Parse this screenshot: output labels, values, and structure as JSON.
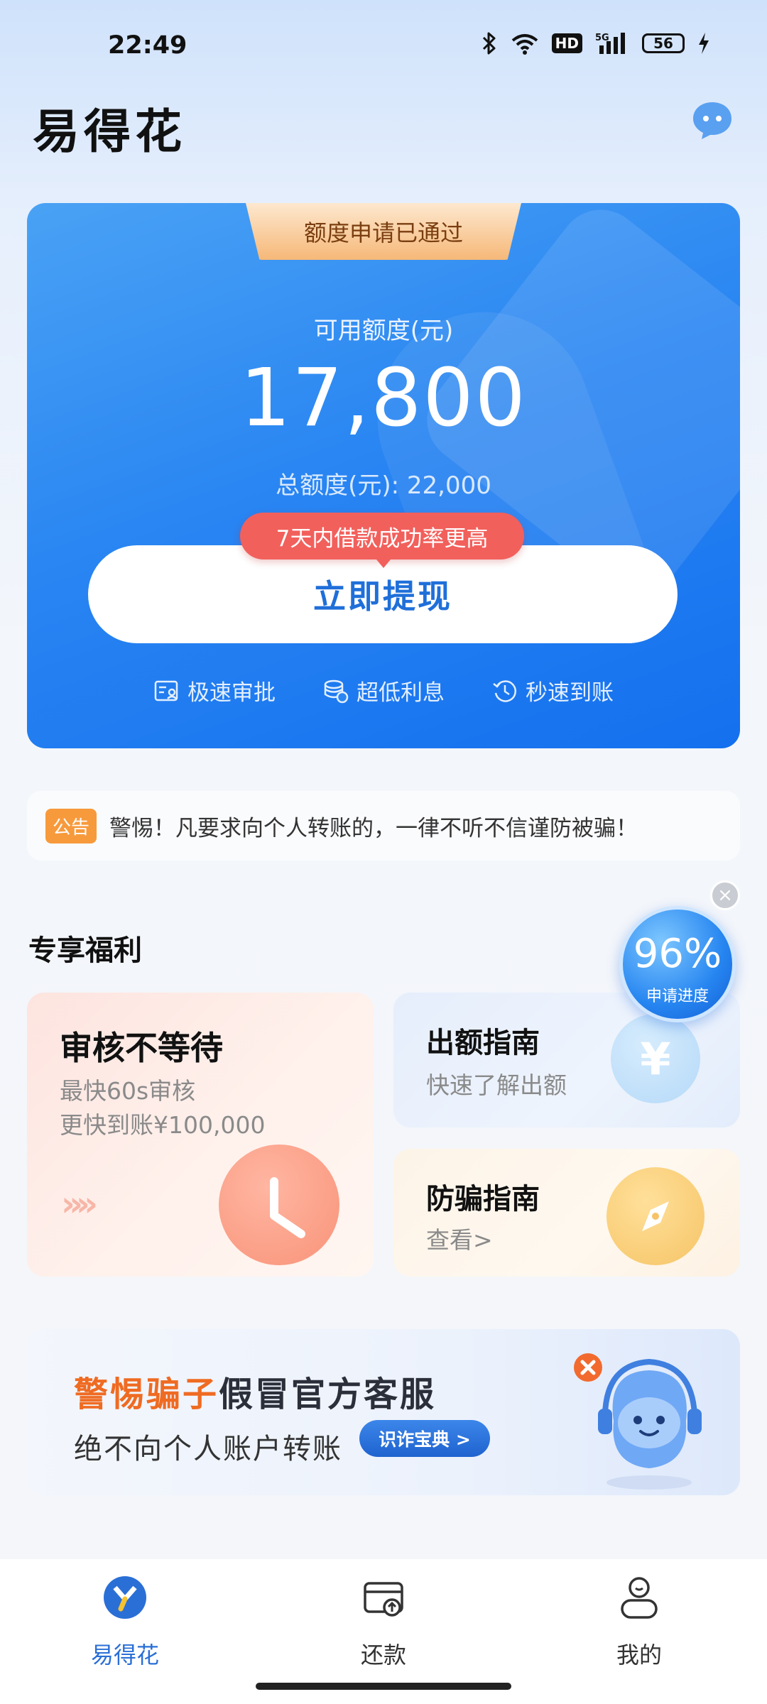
{
  "status_bar": {
    "time": "22:49",
    "hd_badge": "HD",
    "signal_badge": "5G",
    "battery": "56"
  },
  "header": {
    "app_title": "易得花"
  },
  "credit_card": {
    "approved_tab": "额度申请已通过",
    "available_label": "可用额度(元)",
    "available_amount": "17,800",
    "total_label": "总额度(元): 22,000",
    "promo_pill": "7天内借款成功率更高",
    "withdraw_button": "立即提现",
    "features": [
      {
        "label": "极速审批",
        "icon": "approval-icon"
      },
      {
        "label": "超低利息",
        "icon": "coins-icon"
      },
      {
        "label": "秒速到账",
        "icon": "clock-arrival-icon"
      }
    ]
  },
  "notice": {
    "tag": "公告",
    "text": "警惕！凡要求向个人转账的，一律不听不信谨防被骗！"
  },
  "benefits": {
    "title": "专享福利",
    "progress": {
      "value": "96%",
      "label": "申请进度",
      "close": "×"
    },
    "review_card": {
      "title": "审核不等待",
      "line1": "最快60s审核",
      "line2": "更快到账¥100,000",
      "chevrons": "»»",
      "icon": "clock-icon"
    },
    "quota_card": {
      "title": "出额指南",
      "subtitle": "快速了解出额",
      "icon_glyph": "¥",
      "icon": "yen-icon"
    },
    "fraud_card": {
      "title": "防骗指南",
      "subtitle": "查看>",
      "icon": "compass-icon"
    }
  },
  "banner": {
    "title_highlight": "警惕骗子",
    "title_rest": "假冒官方客服",
    "subtitle": "绝不向个人账户转账",
    "button": "识诈宝典 >"
  },
  "bottom_nav": [
    {
      "label": "易得花",
      "active": true,
      "color": "#2a6fd6"
    },
    {
      "label": "还款",
      "active": false,
      "color": "#333333"
    },
    {
      "label": "我的",
      "active": false,
      "color": "#333333"
    }
  ],
  "colors": {
    "accent": "#1f6fd9",
    "promo": "#f2605c",
    "notice_tag": "#f79a3c",
    "warning_orange": "#ef6b22"
  }
}
